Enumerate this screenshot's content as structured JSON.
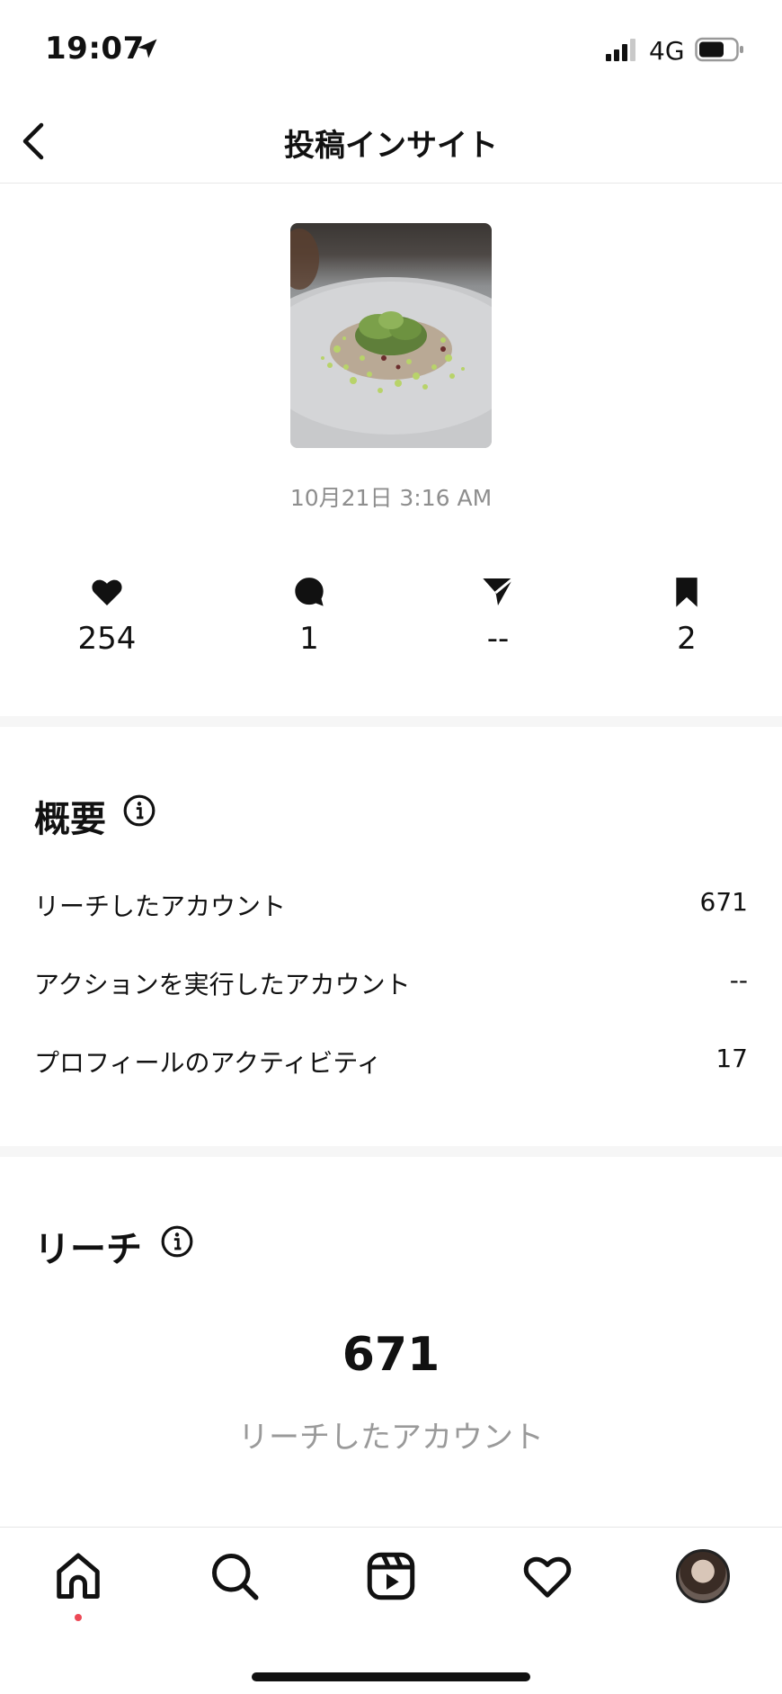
{
  "status_bar": {
    "time": "19:07",
    "network": "4G",
    "icons": [
      "location-arrow-icon",
      "signal-icon",
      "battery-icon"
    ]
  },
  "nav": {
    "title": "投稿インサイト",
    "back_icon": "chevron-left-icon"
  },
  "post": {
    "date": "10月21日 3:16 AM"
  },
  "metrics": [
    {
      "icon": "heart-icon",
      "value": "254"
    },
    {
      "icon": "comment-icon",
      "value": "1"
    },
    {
      "icon": "share-icon",
      "value": "--"
    },
    {
      "icon": "bookmark-icon",
      "value": "2"
    }
  ],
  "overview": {
    "title": "概要",
    "rows": [
      {
        "label": "リーチしたアカウント",
        "value": "671"
      },
      {
        "label": "アクションを実行したアカウント",
        "value": "--"
      },
      {
        "label": "プロフィールのアクティビティ",
        "value": "17"
      }
    ]
  },
  "reach": {
    "title": "リーチ",
    "value": "671",
    "label": "リーチしたアカウント"
  },
  "tab_bar": {
    "tabs": [
      "home-icon",
      "search-icon",
      "reels-icon",
      "heart-icon",
      "profile-avatar"
    ],
    "notification_color": "#ed4956"
  }
}
